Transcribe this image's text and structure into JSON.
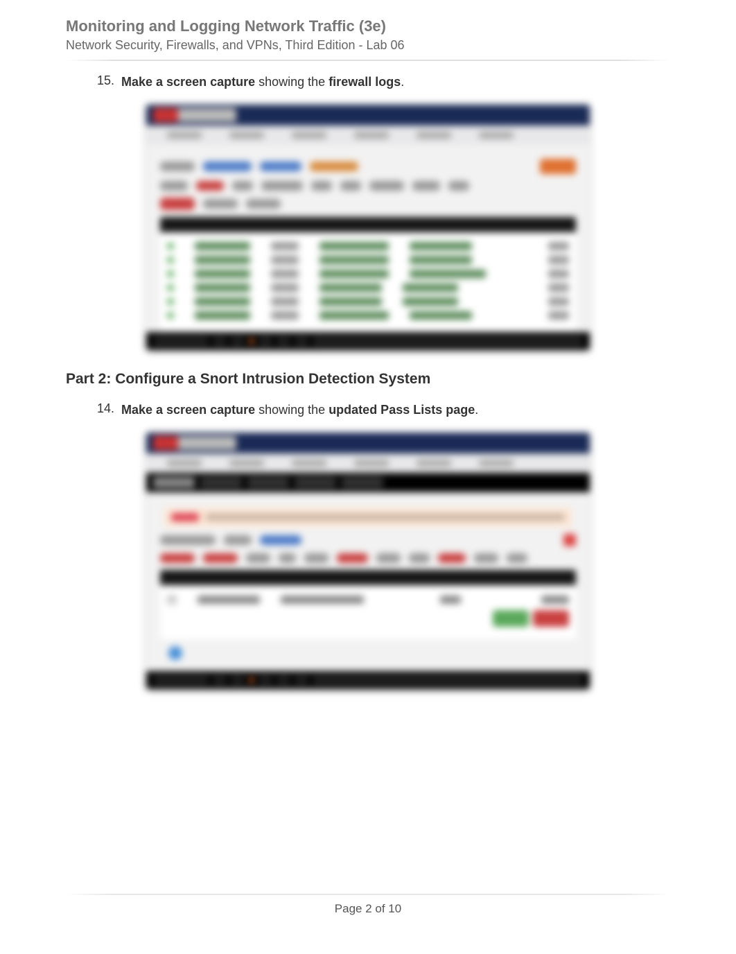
{
  "header": {
    "title": "Monitoring and Logging Network Traffic (3e)",
    "subtitle": "Network Security, Firewalls, and VPNs, Third Edition - Lab 06"
  },
  "items": [
    {
      "number": "15.",
      "bold_lead": "Make a screen capture",
      "middle": " showing the ",
      "bold_tail": "firewall logs",
      "tail": "."
    },
    {
      "number": "14.",
      "bold_lead": "Make a screen capture",
      "middle": " showing the ",
      "bold_tail": "updated Pass Lists page",
      "tail": "."
    }
  ],
  "section_heading": "Part 2: Configure a Snort Intrusion Detection System",
  "footer": {
    "page_label": "Page 2 of 10"
  }
}
